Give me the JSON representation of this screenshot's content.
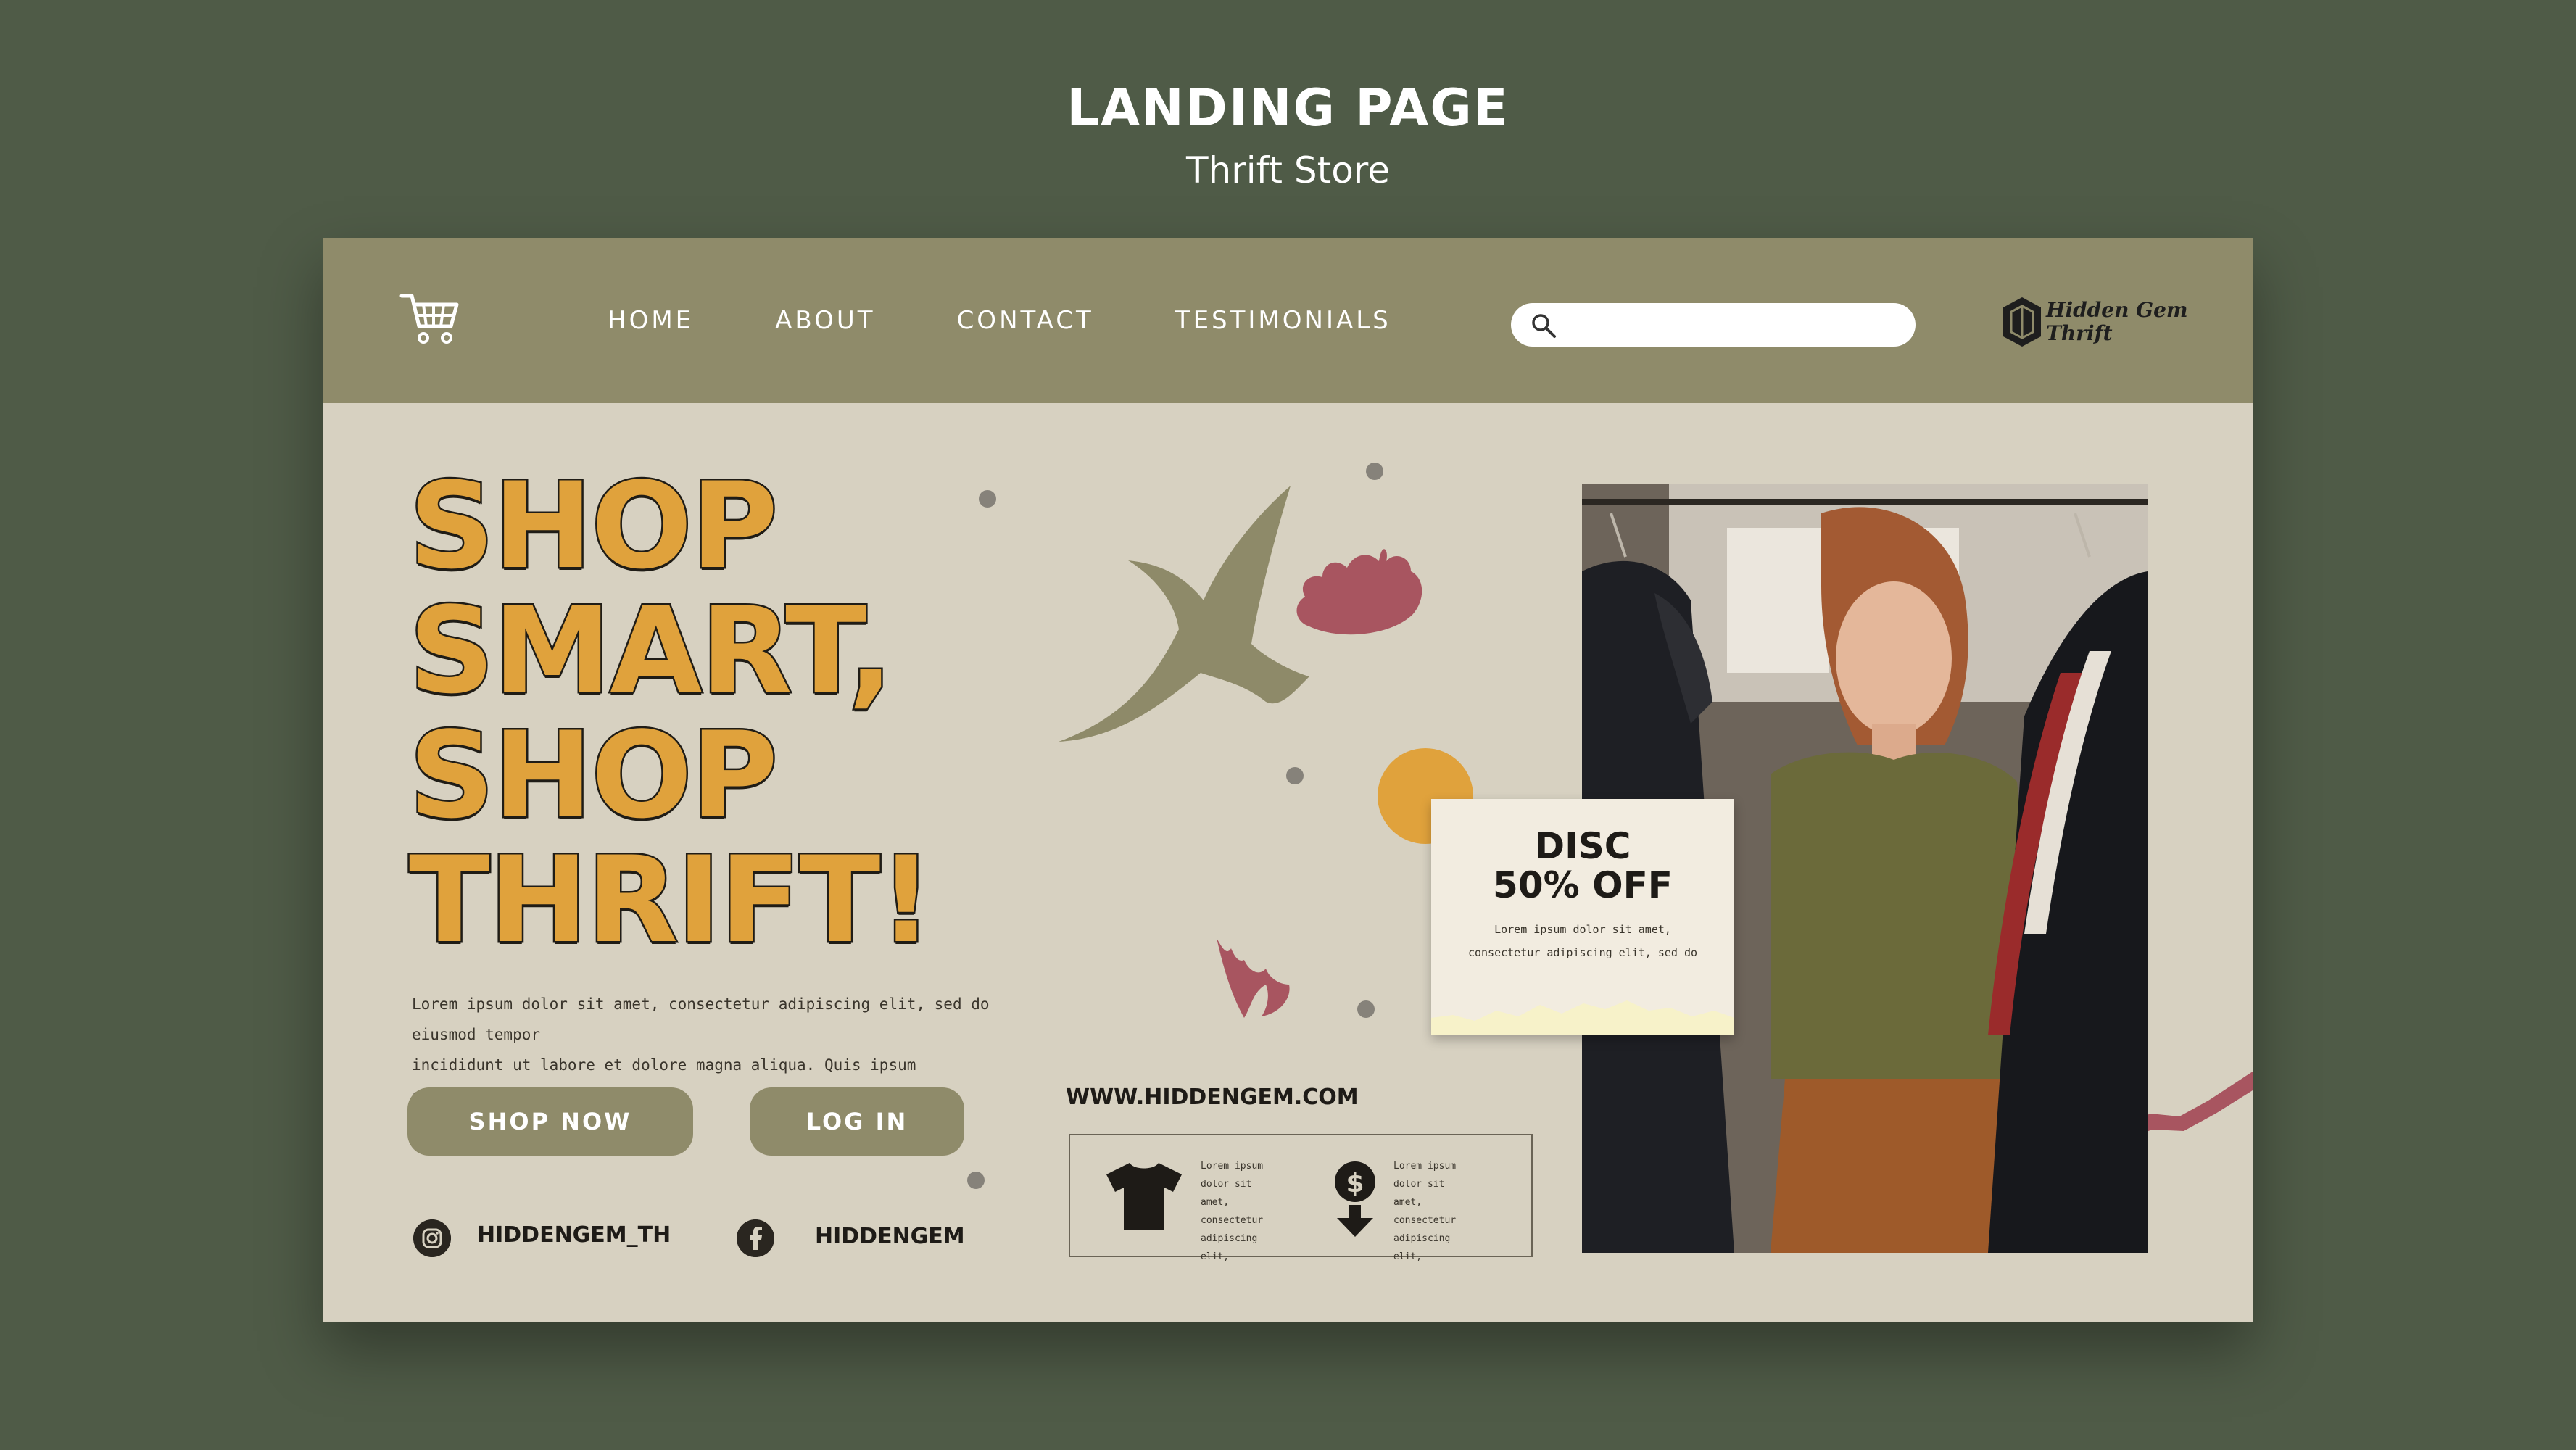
{
  "page": {
    "title": "LANDING PAGE",
    "subtitle": "Thrift Store"
  },
  "nav": {
    "cart_icon": "cart-icon",
    "links": [
      "HOME",
      "ABOUT",
      "CONTACT",
      "TESTIMONIALS"
    ],
    "search_value": "",
    "search_icon": "search-icon",
    "logo_lines": [
      "Hidden Gem",
      "Thrift"
    ]
  },
  "hero": {
    "headline": [
      "SHOP",
      "SMART,",
      "SHOP",
      "THRIFT!"
    ],
    "body_lines": [
      "Lorem ipsum dolor sit amet, consectetur adipiscing elit, sed do eiusmod tempor",
      "incididunt ut labore et dolore magna aliqua. Quis ipsum suspendisse ultrices"
    ],
    "shop_button": "SHOP NOW",
    "login_button": "LOG IN"
  },
  "social": {
    "instagram_handle": "HIDDENGEM_TH",
    "facebook_handle": "HIDDENGEM"
  },
  "info": {
    "website": "WWW.HIDDENGEM.COM",
    "feature_1_text": [
      "Lorem ipsum",
      "dolor sit amet,",
      "consectetur",
      "adipiscing elit,"
    ],
    "feature_2_text": [
      "Lorem ipsum",
      "dolor sit amet,",
      "consectetur",
      "adipiscing elit,"
    ]
  },
  "discount": {
    "line1": "DISC",
    "line2": "50% OFF",
    "body_lines": [
      "Lorem ipsum dolor sit amet,",
      "consectetur adipiscing elit, sed do"
    ]
  },
  "colors": {
    "background": "#4f5b47",
    "nav": "#8f8b6a",
    "paper": "#d7d1c1",
    "headline": "#e0a23c",
    "accent_red": "#a85560",
    "accent_olive": "#8e8a69"
  }
}
